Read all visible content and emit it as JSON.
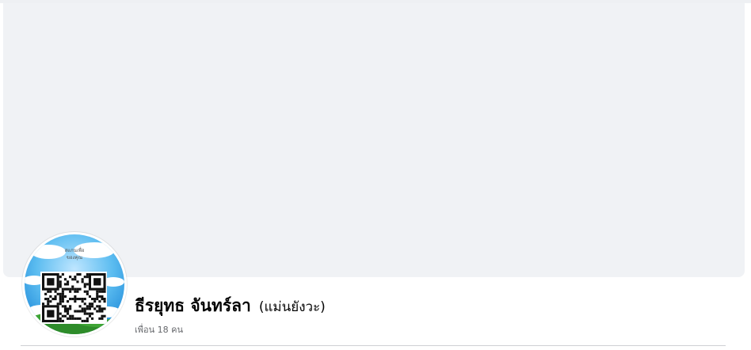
{
  "profile": {
    "name": "ธีรยุทธ จันทร์ลา",
    "alternate_name": "(แม่นยังวะ)",
    "friends_count": "เพื่อน 18 คน",
    "avatar": {
      "icon": "qr-code-icon",
      "caption_line1": "สแกนเพื่อ",
      "caption_line2": "ของคุณ",
      "colors": {
        "sky": "#1e9be3",
        "cloud": "#ffffff",
        "grass": "#3fa535"
      }
    }
  },
  "colors": {
    "cover": "#f0f2f5",
    "name": "#050505",
    "secondary": "#65676b",
    "divider": "#ced0d4"
  }
}
